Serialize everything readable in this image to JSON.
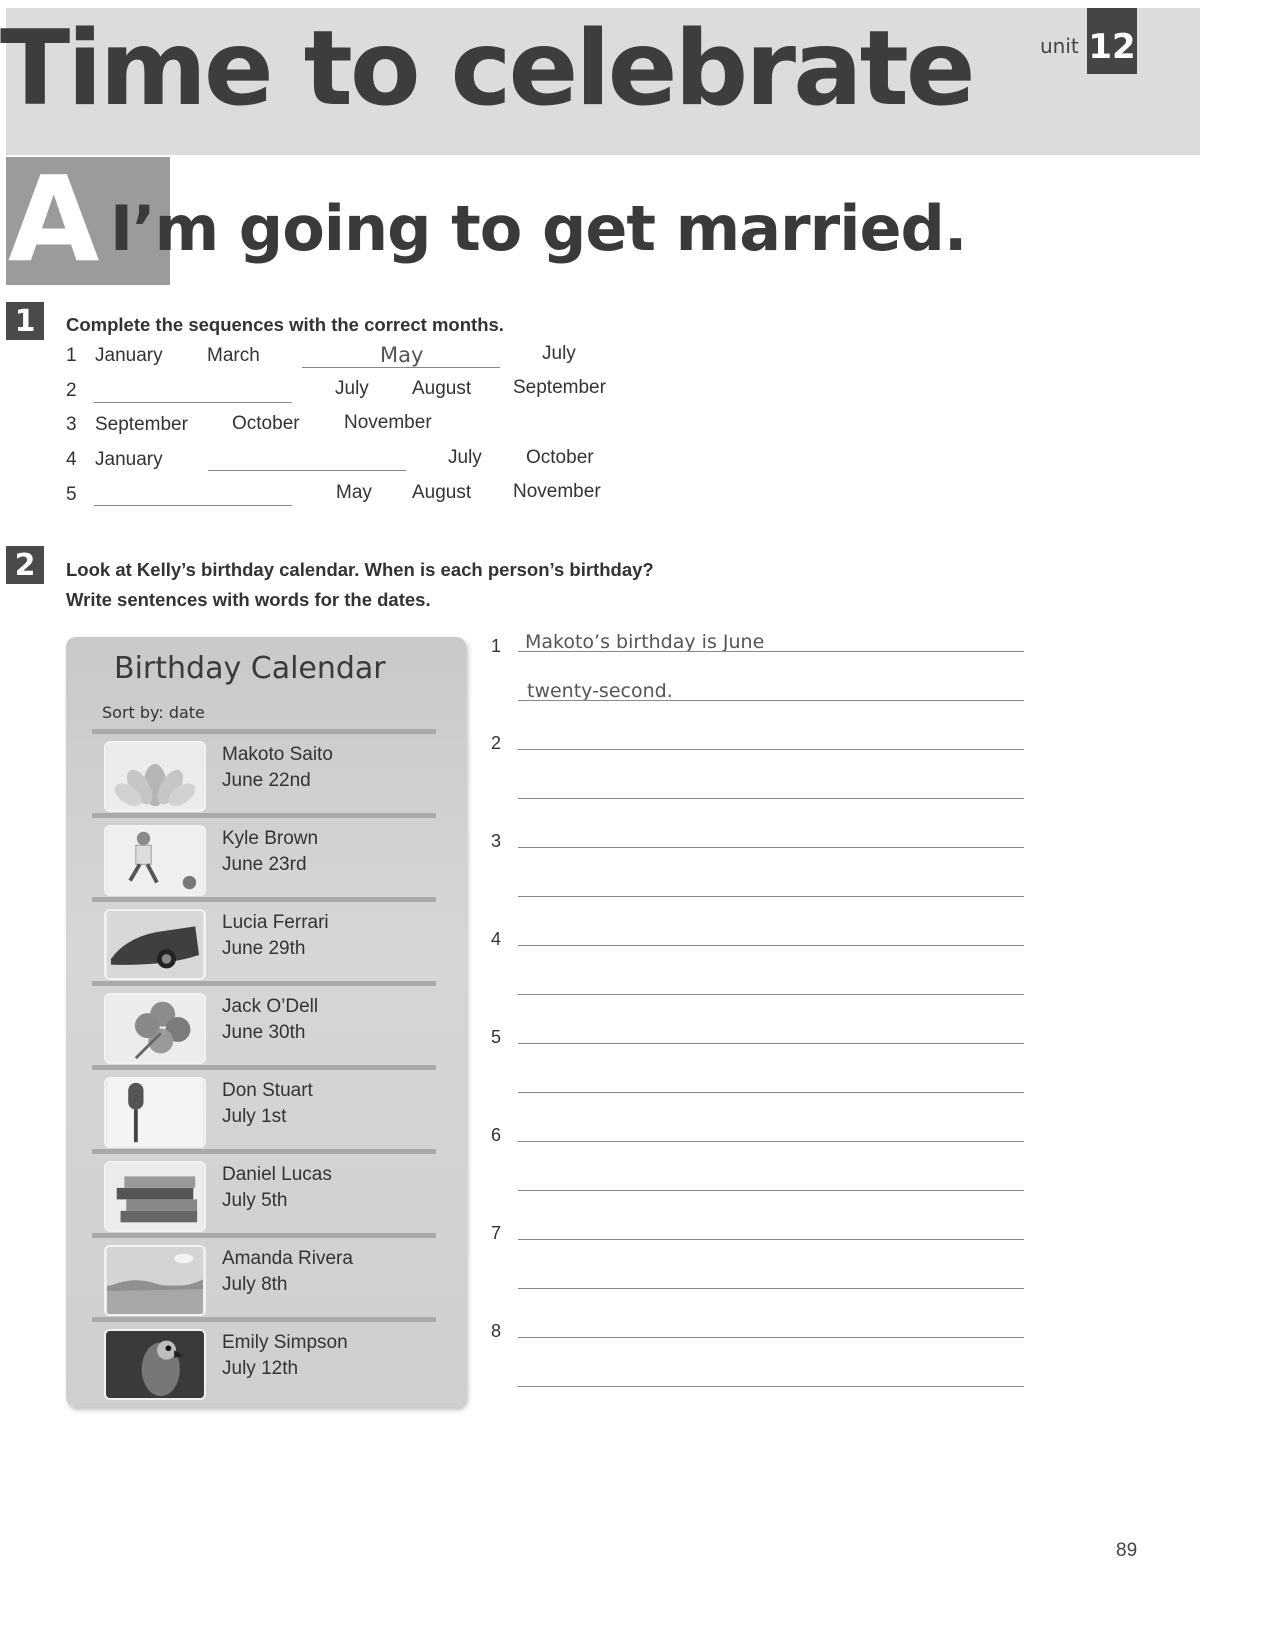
{
  "header": {
    "unit_word": "unit",
    "unit_number": "12",
    "title": "Time to celebrate"
  },
  "lesson": {
    "letter": "A",
    "title": "I’m going to get married."
  },
  "exercise1": {
    "number": "1",
    "instruction": "Complete the sequences with the correct months.",
    "rows": [
      {
        "num": "1",
        "a": "January",
        "b": "March",
        "answer": "May",
        "c": "July"
      },
      {
        "num": "2",
        "a": "July",
        "b": "August",
        "c": "September"
      },
      {
        "num": "3",
        "a": "September",
        "b": "October",
        "c": "November"
      },
      {
        "num": "4",
        "a": "January",
        "b": "July",
        "c": "October"
      },
      {
        "num": "5",
        "a": "May",
        "b": "August",
        "c": "November"
      }
    ]
  },
  "exercise2": {
    "number": "2",
    "instruction_line1": "Look at Kelly’s birthday calendar. When is each person’s birthday?",
    "instruction_line2": "Write sentences with words for the dates.",
    "calendar": {
      "title": "Birthday Calendar",
      "sort_label": "Sort by:  date",
      "entries": [
        {
          "name": "Makoto Saito",
          "date": "June 22nd",
          "icon": "lotus-icon"
        },
        {
          "name": "Kyle Brown",
          "date": "June 23rd",
          "icon": "soccer-player-icon"
        },
        {
          "name": "Lucia Ferrari",
          "date": "June 29th",
          "icon": "car-icon"
        },
        {
          "name": "Jack O’Dell",
          "date": "June 30th",
          "icon": "clover-icon"
        },
        {
          "name": "Don Stuart",
          "date": "July 1st",
          "icon": "microphone-icon"
        },
        {
          "name": "Daniel Lucas",
          "date": "July 5th",
          "icon": "books-icon"
        },
        {
          "name": "Amanda Rivera",
          "date": "July 8th",
          "icon": "landscape-icon"
        },
        {
          "name": "Emily Simpson",
          "date": "July 12th",
          "icon": "parrot-icon"
        }
      ]
    },
    "answers": {
      "numbers": [
        "1",
        "2",
        "3",
        "4",
        "5",
        "6",
        "7",
        "8"
      ],
      "example_line1": "Makoto’s birthday is June",
      "example_line2": "twenty-second."
    }
  },
  "page_number": "89"
}
